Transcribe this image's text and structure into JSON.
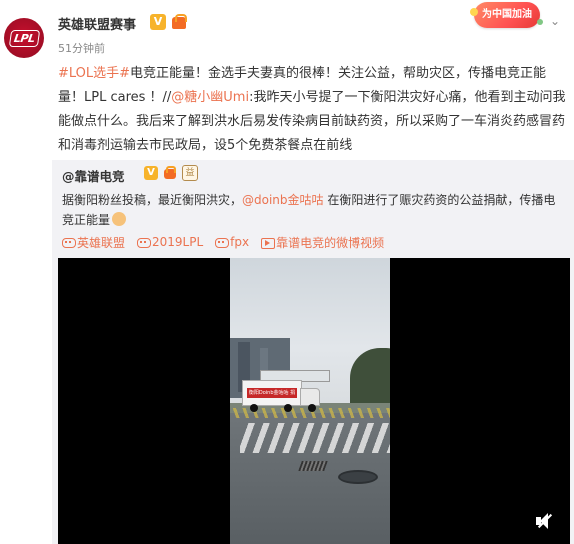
{
  "post": {
    "author": "英雄联盟赛事",
    "avatar_text": "LPL",
    "verified_mark": "V",
    "timestamp": "51分钟前",
    "promo_badge": "为中国加油",
    "text_segments": {
      "tag1": "#LOL选手#",
      "text1": "电竞正能量！金选手夫妻真的很棒！关注公益，帮助灾区，传播电竞正能量！LPL cares ！//",
      "mention": "@糖小幽Umi",
      "text2": ":我昨天小号提了一下衡阳洪灾好心痛，他看到主动问我能做点什么。我后来了解到洪水后易发传染病目前缺药资，所以采购了一车消炎药感冒药和消毒剂运输去市民政局，设5个免费茶餐点在前线"
    }
  },
  "repost": {
    "author": "@靠谱电竞",
    "verified_mark": "V",
    "badge_text": "益",
    "text1": "据衡阳粉丝投稿，最近衡阳洪灾，",
    "mention": "@doinb金咕咕",
    "text2": " 在衡阳进行了赈灾药资的公益捐献，传播电竞正能量",
    "topics": [
      {
        "label": "英雄联盟",
        "icon": "game-icon"
      },
      {
        "label": "2019LPL",
        "icon": "game-icon"
      },
      {
        "label": "fpx",
        "icon": "game-icon"
      },
      {
        "label": "靠谱电竞的微博视频",
        "icon": "video-icon"
      }
    ],
    "video": {
      "truck_text": "衡阳Doinb金咕咕 捐药支援"
    }
  }
}
